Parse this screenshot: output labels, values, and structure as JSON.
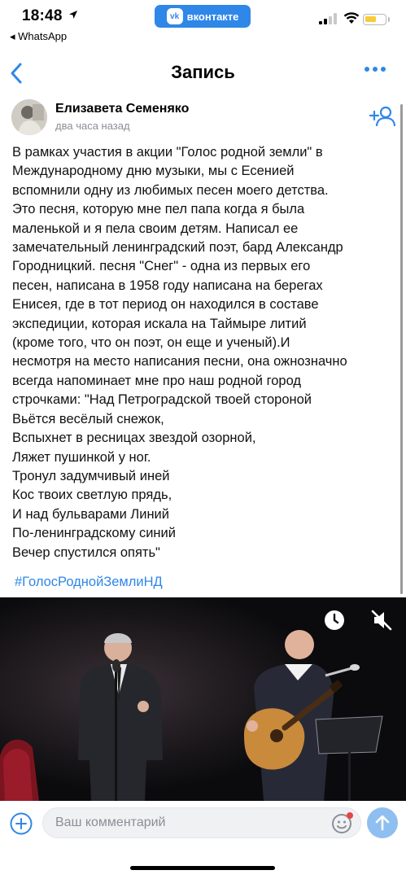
{
  "status_bar": {
    "time": "18:48",
    "back_app": "◂ WhatsApp",
    "vk_badge": "вконтакте",
    "vk_logo": "vk",
    "battery_color": "#f7cc35"
  },
  "nav": {
    "title": "Запись"
  },
  "post": {
    "author": "Елизавета Семеняко",
    "time": "два часа назад",
    "text": "В рамках участия в акции \"Голос родной земли\" в\nМеждународному дню музыки, мы с Есенией\nвспомнили одну из любимых песен моего детства.\nЭто песня, которую мне пел папа когда я была\nмаленькой и я пела своим детям. Написал ее\nзамечательный ленинградский поэт, бард Александр\nГородницкий. песня \"Снег\" - одна из первых его\nпесен, написана в 1958 году написана на берегах\nЕнисея, где в тот период он находился в составе\nэкспедиции, которая искала на Таймыре литий\n(кроме того, что он поэт, он еще и ученый).И\nнесмотря на место написания песни, она ожнозначно\nвсегда напоминает мне про наш родной город\nстрочками: \"Над Петроградской твоей стороной\nВьётся весёлый снежок,\nВспыхнет в ресницах звездой озорной,\nЛяжет пушинкой у ног.\nТронул задумчивый иней\nКос твоих светлую прядь,\nИ над бульварами Линий\nПо-ленинградскому синий\nВечер спустился опять\"",
    "hashtag": "#ГолосРоднойЗемлиНД"
  },
  "comment": {
    "placeholder": "Ваш комментарий"
  },
  "colors": {
    "accent": "#2f87e8",
    "send_disabled": "#8fbff0"
  }
}
